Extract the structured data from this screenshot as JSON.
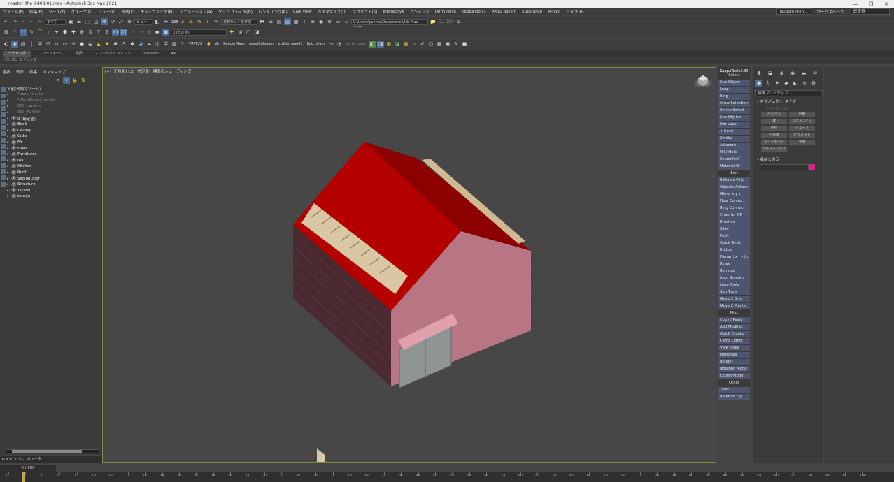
{
  "window": {
    "title": "master_the_0408-01.max - Autodesk 3ds Max 2021",
    "controls": [
      "—",
      "❐",
      "✕"
    ]
  },
  "menu": {
    "items": [
      "ファイル(F)",
      "編集(E)",
      "ツール(T)",
      "グループ(G)",
      "ビュー(V)",
      "作成(C)",
      "モディファイヤ(M)",
      "アニメーション(A)",
      "グラフ エディタ(D)",
      "レンダリング(R)",
      "Civil View",
      "カスタマイズ(U)",
      "スクリプト(S)",
      "Interactive",
      "コンテンツ",
      "Omniverse",
      "KappaTools3",
      "AXYZ design",
      "Substance",
      "Arnold",
      "ヘルプ(H)"
    ],
    "user": "Tsuguto Nishi...",
    "workspace_label": "ワークスペース:",
    "workspace_value": "既定値"
  },
  "toolbar1": {
    "filter": "すべて",
    "view": "ビュー",
    "selection_set": "選択セットを作成",
    "path": "C:\\Users\\yonme\\Documents\\3ds Max 2021"
  },
  "toolbar2": {
    "layer": "0 (既定値)"
  },
  "toolbar3": {
    "labels": [
      "VRPP26",
      "RenderMask",
      "assetCollector",
      "idyDamage01",
      "BatchCam",
      "on 1x tasks"
    ]
  },
  "ribbon": {
    "tabs": [
      "モデリング",
      "フリーフォーム",
      "選択",
      "オブジェクト ペイント",
      "Populate"
    ],
    "sub": "ポリゴン モデリング"
  },
  "scene_explorer": {
    "tabs": [
      "選択",
      "表示",
      "編集",
      "カスタマイズ"
    ],
    "header": "名前(昇順でソート)",
    "rows": [
      {
        "name": "*book_master",
        "dim": true
      },
      {
        "name": "*WoodPanel_master",
        "dim": true
      },
      {
        "name": "000_camera",
        "dim": true
      },
      {
        "name": "000_FUYOU",
        "dim": true
      },
      {
        "name": "0 (既定値)",
        "dim": false
      },
      {
        "name": "Book",
        "dim": false
      },
      {
        "name": "Ceiling",
        "dim": false
      },
      {
        "name": "Cube",
        "dim": false
      },
      {
        "name": "EX",
        "dim": false
      },
      {
        "name": "Floor",
        "dim": false
      },
      {
        "name": "Furnitures",
        "dim": false
      },
      {
        "name": "INT",
        "dim": false
      },
      {
        "name": "Kitchen",
        "dim": false
      },
      {
        "name": "Roof",
        "dim": false
      },
      {
        "name": "SlidingDoor",
        "dim": false
      },
      {
        "name": "Structure",
        "dim": false
      },
      {
        "name": "Tatami",
        "dim": false
      },
      {
        "name": "tategu",
        "dim": false
      }
    ],
    "layer_explorer": "レイヤ エクスプローラ",
    "frame": "0 / 100"
  },
  "viewport": {
    "label": "[+] [正投影] [ユーザ定義] [標準のシェーディング]"
  },
  "kappa": {
    "title": "KappaTools3.36",
    "buttons": [
      "Select",
      "Sub Object",
      "Loop",
      "Ring",
      "Grow Selection",
      "Shrink Select",
      "Sub Obj.Iso",
      "Dot Loop",
      "+ Save",
      "Similar",
      "Adjacent",
      "Fill / Hole",
      "Select Half",
      "Material ID",
      "Edit",
      "Editable Poly",
      "Objects Actions",
      "Mirror   x  y  z",
      "Flow Connect",
      "Ring Connect",
      "Chamfer OP",
      "Brushes",
      "Slide",
      "Push",
      "Quick Tools",
      "Bridge",
      "Planar | x | y | z",
      "Relax",
      "Remove",
      "Auto Smooth",
      "Loop Tools",
      "Sub Tools",
      "Move 2 Grid",
      "Move 2 Points",
      "Misc",
      "Copy / Paste",
      "Add Modifier",
      "Quick Create",
      "Cams Lights",
      "View Tools",
      "Materials",
      "Render",
      "Isolation Mode",
      "Expert Mode",
      "Other",
      "Tools",
      "Random Fly"
    ]
  },
  "command_panel": {
    "dropdown": "標準プリミティブ",
    "object_type": "オブジェクト タイプ",
    "autogrid": "オートグリッド",
    "primitives": [
      "ボックス",
      "円錐",
      "球",
      "ジオスフィア",
      "円柱",
      "チューブ",
      "円環体",
      "ピラミッド",
      "ティーポット",
      "平面",
      "テキストプラス"
    ],
    "name_color": "名前とカラー",
    "swatch_color": "#d9258a"
  },
  "timeline": {
    "ticks": [
      "0",
      "2",
      "4",
      "6",
      "8",
      "10",
      "12",
      "14",
      "16",
      "18",
      "20",
      "22",
      "24",
      "26",
      "28",
      "30",
      "32",
      "34",
      "36",
      "38",
      "40",
      "42",
      "44",
      "46",
      "48",
      "50",
      "52",
      "54",
      "56",
      "58",
      "60",
      "62",
      "64",
      "66",
      "68",
      "70",
      "72",
      "74",
      "76",
      "78",
      "80",
      "82",
      "84",
      "86",
      "88",
      "90",
      "92",
      "94",
      "96",
      "98",
      "100"
    ]
  }
}
